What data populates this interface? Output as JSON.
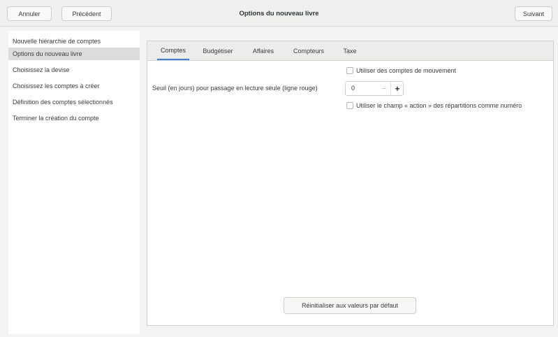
{
  "header": {
    "cancel_label": "Annuler",
    "previous_label": "Précédent",
    "title": "Options du nouveau livre",
    "next_label": "Suivant"
  },
  "sidebar": {
    "items": [
      {
        "label": "Nouvelle hiérarchie de comptes"
      },
      {
        "label": "Options du nouveau livre"
      },
      {
        "label": "Choisissez la devise"
      },
      {
        "label": "Choisissez les comptes à créer"
      },
      {
        "label": "Définition des comptes sélectionnés"
      },
      {
        "label": "Terminer la création du compte"
      }
    ],
    "selected_index": 1
  },
  "tabs": [
    {
      "label": "Comptes"
    },
    {
      "label": "Budgétiser"
    },
    {
      "label": "Affaires"
    },
    {
      "label": "Compteurs"
    },
    {
      "label": "Taxe"
    }
  ],
  "active_tab": 0,
  "comptes": {
    "trading_accounts_label": "Utiliser des comptes de mouvement",
    "trading_accounts_checked": false,
    "readonly_threshold_label": "Seuil (en jours) pour passage en lecture seule (ligne rouge)",
    "readonly_threshold_value": "0",
    "spin_minus": "−",
    "spin_plus": "+",
    "split_action_label": "Utiliser le champ « action » des répartitions comme numéro",
    "split_action_checked": false
  },
  "reset_button_label": "Réinitialiser aux valeurs par défaut",
  "colors": {
    "accent": "#3584e4",
    "selected_row": "#dcdcdb",
    "header_bg": "#efefed"
  }
}
